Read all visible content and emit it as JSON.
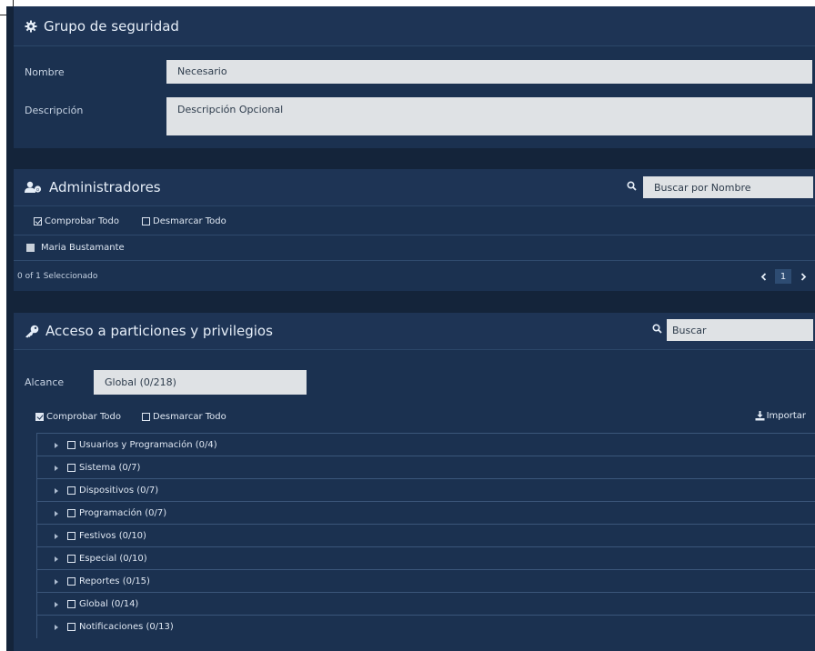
{
  "security_group": {
    "title": "Grupo de seguridad",
    "icon": "gear-icon",
    "name_label": "Nombre",
    "name_value": "Necesario",
    "description_label": "Descripción",
    "description_value": "Descripción Opcional"
  },
  "administrators": {
    "title": "Administradores",
    "icon": "users-icon",
    "search_placeholder": "Buscar por Nombre",
    "check_all": "Comprobar Todo",
    "uncheck_all": "Desmarcar Todo",
    "items": [
      {
        "label": "Maria Bustamante",
        "checked": false
      }
    ],
    "selection_status": "0 of 1 Seleccionado",
    "page": "1"
  },
  "partitions": {
    "title": "Acceso a particiones y privilegios",
    "icon": "key-icon",
    "search_placeholder": "Buscar",
    "scope_label": "Alcance",
    "scope_value": "Global (0/218)",
    "check_all": "Comprobar Todo",
    "uncheck_all": "Desmarcar Todo",
    "import_label": "Importar",
    "tree": [
      {
        "label": "Usuarios y Programación (0/4)"
      },
      {
        "label": "Sistema (0/7)"
      },
      {
        "label": "Dispositivos (0/7)"
      },
      {
        "label": "Programación (0/7)"
      },
      {
        "label": "Festivos (0/10)"
      },
      {
        "label": "Especial (0/10)"
      },
      {
        "label": "Reportes (0/15)"
      },
      {
        "label": "Global (0/14)"
      },
      {
        "label": "Notificaciones (0/13)"
      }
    ]
  },
  "colors": {
    "background": "#14243a",
    "panel": "#1b3150",
    "field": "#dfe2e5"
  }
}
